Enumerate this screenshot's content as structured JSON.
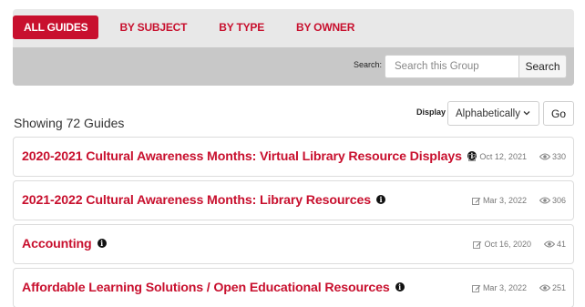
{
  "nav": {
    "tabs": [
      {
        "label": "ALL GUIDES",
        "active": true
      },
      {
        "label": "BY SUBJECT",
        "active": false
      },
      {
        "label": "BY TYPE",
        "active": false
      },
      {
        "label": "BY OWNER",
        "active": false
      }
    ]
  },
  "search": {
    "label": "Search:",
    "placeholder": "Search this Group",
    "button": "Search"
  },
  "summary": {
    "showing": "Showing 72 Guides"
  },
  "display": {
    "label": "Display",
    "selected": "Alphabetically",
    "go": "Go"
  },
  "guides": [
    {
      "title": "2020-2021 Cultural Awareness Months: Virtual Library Resource Displays",
      "updated": "Oct 12, 2021",
      "views": "330"
    },
    {
      "title": "2021-2022 Cultural Awareness Months: Library Resources",
      "updated": "Mar 3, 2022",
      "views": "306"
    },
    {
      "title": "Accounting",
      "updated": "Oct 16, 2020",
      "views": "41"
    },
    {
      "title": "Affordable Learning Solutions / Open Educational Resources",
      "updated": "Mar 3, 2022",
      "views": "251"
    }
  ],
  "colors": {
    "accent": "#c8102e",
    "panel": "#e8e8e8",
    "search_bar": "#c8c8c8"
  },
  "icons": {
    "info": "info-icon",
    "edit": "edit-icon",
    "views": "eye-icon",
    "select": "chevron-down-icon"
  }
}
